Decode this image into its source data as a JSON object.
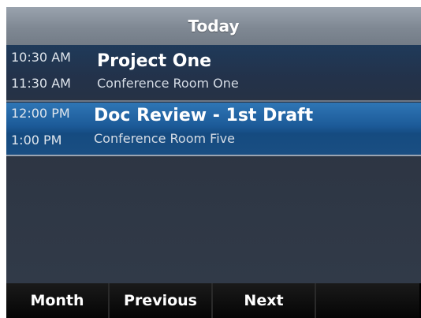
{
  "header": {
    "title": "Today"
  },
  "events": [
    {
      "start": "10:30 AM",
      "end": "11:30 AM",
      "title": "Project One",
      "location": "Conference Room One",
      "selected": false
    },
    {
      "start": "12:00 PM",
      "end": "1:00 PM",
      "title": "Doc Review - 1st Draft",
      "location": "Conference Room Five",
      "selected": true
    }
  ],
  "softkeys": [
    {
      "label": "Month"
    },
    {
      "label": "Previous"
    },
    {
      "label": "Next"
    },
    {
      "label": ""
    }
  ],
  "colors": {
    "selected_row": "#1c5a98",
    "background": "#2e3744",
    "header": "#7f8893",
    "softkey_bar": "#000000"
  }
}
